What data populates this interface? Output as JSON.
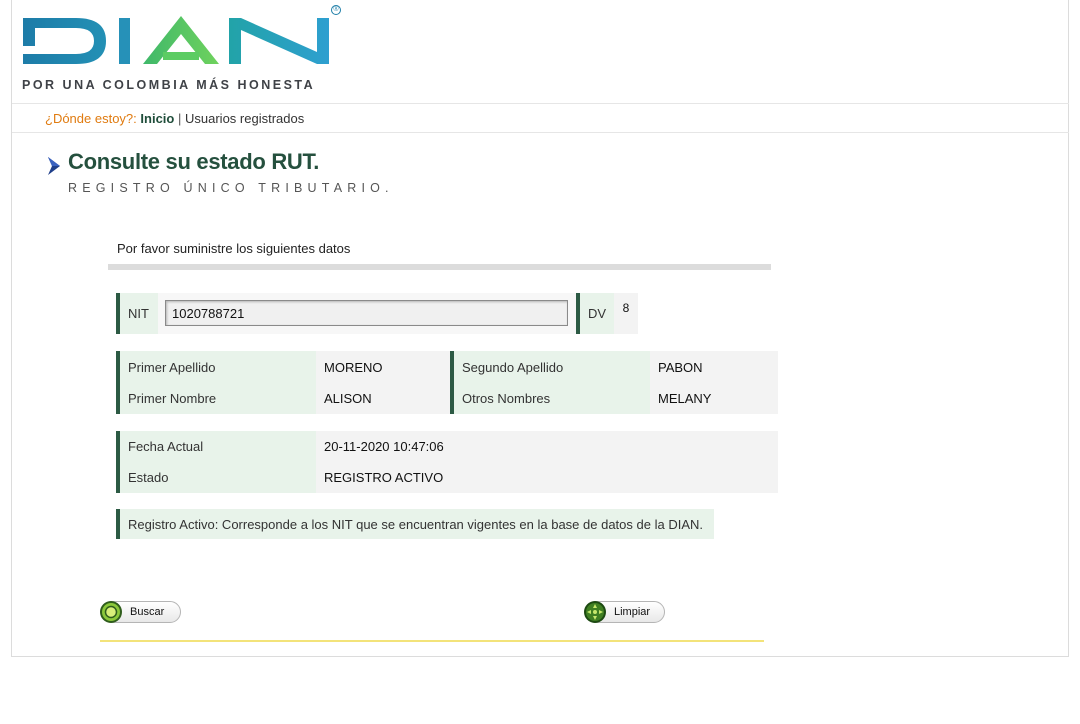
{
  "header": {
    "logo_text": "DIAN",
    "tagline": "POR UNA COLOMBIA MÁS HONESTA",
    "registered_mark": "®"
  },
  "breadcrumb": {
    "prompt": "¿Dónde estoy?:",
    "home": "Inicio",
    "separator": "|",
    "current": "Usuarios registrados"
  },
  "page": {
    "title": "Consulte su estado RUT.",
    "subtitle": "REGISTRO ÚNICO TRIBUTARIO."
  },
  "form": {
    "instructions": "Por favor suministre los siguientes datos",
    "nit_label": "NIT",
    "nit_value": "1020788721",
    "dv_label": "DV",
    "dv_value": "8"
  },
  "result": {
    "primer_apellido_label": "Primer Apellido",
    "primer_apellido_value": "MORENO",
    "segundo_apellido_label": "Segundo Apellido",
    "segundo_apellido_value": "PABON",
    "primer_nombre_label": "Primer Nombre",
    "primer_nombre_value": "ALISON",
    "otros_nombres_label": "Otros Nombres",
    "otros_nombres_value": "MELANY",
    "fecha_label": "Fecha Actual",
    "fecha_value": "20-11-2020 10:47:06",
    "estado_label": "Estado",
    "estado_value": "REGISTRO ACTIVO",
    "note": "Registro Activo: Corresponde a los NIT que se encuentran vigentes en la base de datos de la DIAN."
  },
  "buttons": {
    "search": "Buscar",
    "clear": "Limpiar"
  },
  "icons": {
    "title_arrow": "chevron-right-icon",
    "search": "search-icon",
    "clear": "clear-icon"
  },
  "colors": {
    "brand_blue": "#1e7ea8",
    "brand_green": "#4fc56b",
    "title_green": "#25503e",
    "accent_orange": "#e07b10"
  }
}
